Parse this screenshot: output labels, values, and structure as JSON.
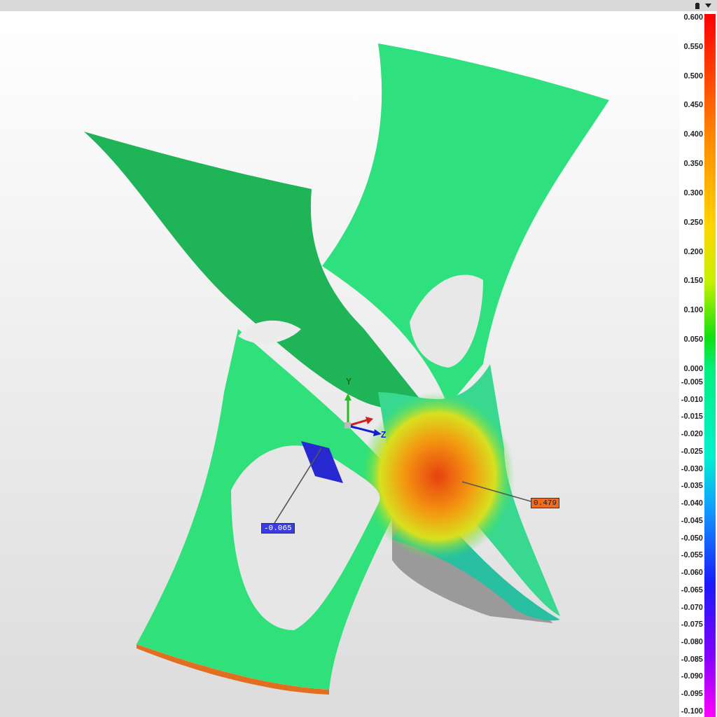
{
  "annotations": [
    {
      "text": "-0.065",
      "color": "#3b3be6"
    },
    {
      "text": "0.479",
      "color": "#f06a22"
    }
  ],
  "axes": [
    "Y",
    "Z"
  ],
  "scale": {
    "upper_labels": [
      "0.600",
      "0.550",
      "0.500",
      "0.450",
      "0.400",
      "0.350",
      "0.300",
      "0.250",
      "0.200",
      "0.150",
      "0.100",
      "0.050",
      "0.000"
    ],
    "lower_labels": [
      "-0.005",
      "-0.010",
      "-0.015",
      "-0.020",
      "-0.025",
      "-0.030",
      "-0.035",
      "-0.040",
      "-0.045",
      "-0.050",
      "-0.055",
      "-0.060",
      "-0.065",
      "-0.070",
      "-0.075",
      "-0.080",
      "-0.085",
      "-0.090",
      "-0.095",
      "-0.100"
    ]
  }
}
